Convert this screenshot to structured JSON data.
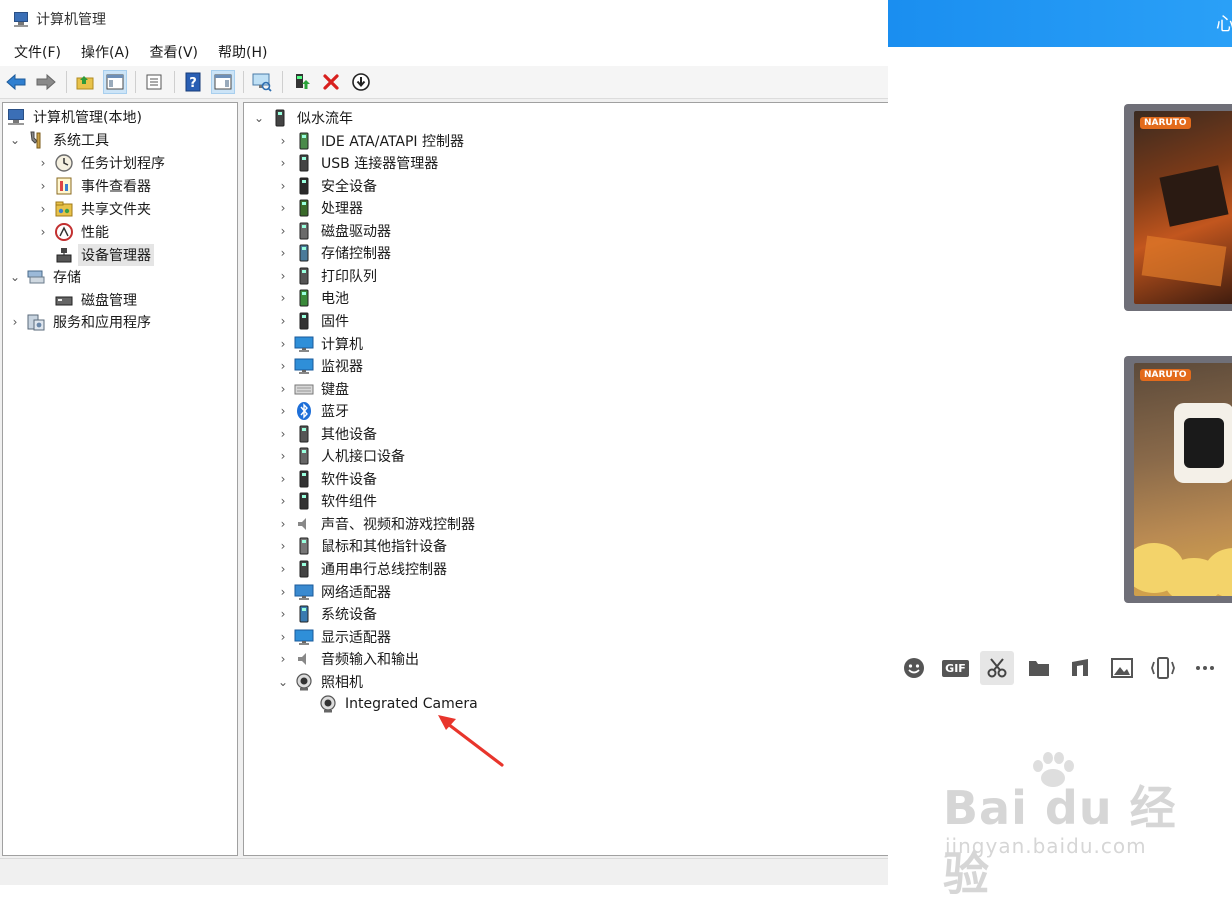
{
  "window": {
    "title": "计算机管理"
  },
  "menu": [
    "文件(F)",
    "操作(A)",
    "查看(V)",
    "帮助(H)"
  ],
  "toolbar": {
    "icons": [
      "back-arrow-icon",
      "forward-arrow-icon",
      "up-folder-icon",
      "show-hide-tree-icon",
      "export-list-icon",
      "help-icon",
      "action-pane-icon",
      "scan-hardware-icon",
      "enable-device-icon",
      "uninstall-device-icon",
      "update-driver-icon"
    ]
  },
  "leftTree": {
    "root": "计算机管理(本地)",
    "systemTools": "系统工具",
    "taskScheduler": "任务计划程序",
    "eventViewer": "事件查看器",
    "sharedFolders": "共享文件夹",
    "performance": "性能",
    "deviceManager": "设备管理器",
    "storage": "存储",
    "diskManagement": "磁盘管理",
    "services": "服务和应用程序"
  },
  "deviceTree": {
    "computerName": "似水流年",
    "categories": [
      "IDE ATA/ATAPI 控制器",
      "USB 连接器管理器",
      "安全设备",
      "处理器",
      "磁盘驱动器",
      "存储控制器",
      "打印队列",
      "电池",
      "固件",
      "计算机",
      "监视器",
      "键盘",
      "蓝牙",
      "其他设备",
      "人机接口设备",
      "软件设备",
      "软件组件",
      "声音、视频和游戏控制器",
      "鼠标和其他指针设备",
      "通用串行总线控制器",
      "网络适配器",
      "系统设备",
      "显示适配器",
      "音频输入和输出",
      "照相机"
    ],
    "cameraDevice": "Integrated Camera"
  },
  "chat": {
    "headerText": "心",
    "card1Brand": "NARUTO",
    "card2Brand": "NARUTO",
    "gifLabel": "GIF",
    "emojiBarIcons": [
      "emoji-icon",
      "gif-icon",
      "scissors-icon",
      "folder-icon",
      "music-icon",
      "image-icon",
      "shake-icon",
      "more-icon"
    ]
  },
  "watermark": {
    "brand": "Bai du 经验",
    "url": "jingyan.baidu.com"
  },
  "colors": {
    "accent": "#1a8ef0",
    "arrow": "#e8352c",
    "selection": "#cce4f7"
  }
}
